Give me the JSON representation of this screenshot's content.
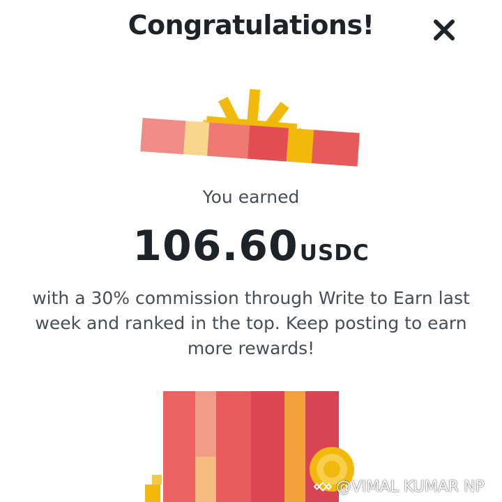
{
  "dialog": {
    "title": "Congratulations!",
    "close_icon": "close-icon",
    "earned_label": "You earned",
    "amount": "106.60",
    "currency": "USDC",
    "message": "with a 30% commission through Write to Earn last week and ranked in the top. Keep posting to earn more rewards!"
  },
  "watermark": {
    "text": "@VIMAL KUMAR NP",
    "icon": "binance-logo-icon"
  },
  "colors": {
    "title_text": "#1e2329",
    "body_text": "#474d57",
    "gift_red": "#e65a5a",
    "gift_pink": "#ef8c87",
    "gift_yellow": "#f0b90b",
    "gift_light": "#f8d78c"
  }
}
